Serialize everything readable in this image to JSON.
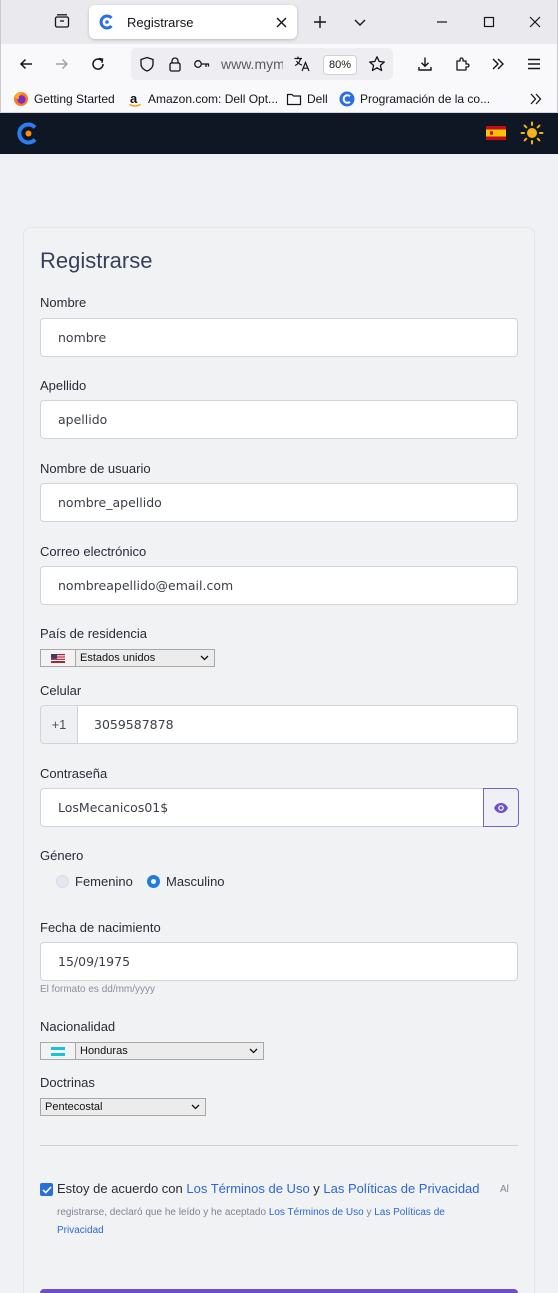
{
  "browser": {
    "tab_title": "Registrarse",
    "url_text": "www.mym",
    "zoom": "80%",
    "bookmarks": [
      {
        "label": "Getting Started",
        "icon": "firefox-icon"
      },
      {
        "label": "Amazon.com: Dell Opt...",
        "icon": "amazon-icon"
      },
      {
        "label": "Dell",
        "icon": "folder-icon"
      },
      {
        "label": "Programación de la co...",
        "icon": "site-c-icon"
      }
    ]
  },
  "site": {
    "language_flag": "es-flag",
    "theme_toggle": "sun-icon"
  },
  "form": {
    "title": "Registrarse",
    "fields": {
      "first_name": {
        "label": "Nombre",
        "value": "nombre"
      },
      "last_name": {
        "label": "Apellido",
        "value": "apellido"
      },
      "username": {
        "label": "Nombre de usuario",
        "value": "nombre_apellido"
      },
      "email": {
        "label": "Correo electrónico",
        "value": "nombreapellido@email.com"
      },
      "country": {
        "label": "País de residencia",
        "value": "Estados unidos"
      },
      "phone": {
        "label": "Celular",
        "prefix": "+1",
        "value": "3059587878"
      },
      "password": {
        "label": "Contraseña",
        "value": "LosMecanicos01$"
      },
      "gender": {
        "label": "Género",
        "options": [
          "Femenino",
          "Masculino"
        ],
        "selected": "Masculino"
      },
      "birthdate": {
        "label": "Fecha de nacimiento",
        "value": "15/09/1975",
        "hint": "El formato es dd/mm/yyyy"
      },
      "nationality": {
        "label": "Nacionalidad",
        "value": "Honduras"
      },
      "doctrine": {
        "label": "Doctrinas",
        "value": "Pentecostal"
      }
    },
    "terms": {
      "checked": true,
      "prefix": "Estoy de acuerdo con ",
      "terms_link": "Los Términos de Uso",
      "connector": " y ",
      "privacy_link": "Las Políticas de Privacidad",
      "small_start": "Al",
      "small_line1_text": "registrarse, declaró que he leído y he aceptado ",
      "small_terms_link": "Los Términos de Uso",
      "small_connector": " y ",
      "small_privacy_link_a": "Las Políticas de",
      "small_privacy_link_b": "Privacidad"
    }
  },
  "colors": {
    "header_bg": "#0f1724",
    "accent": "#6e52c4",
    "link": "#2d67d6",
    "radio_on": "#1e7de0"
  }
}
